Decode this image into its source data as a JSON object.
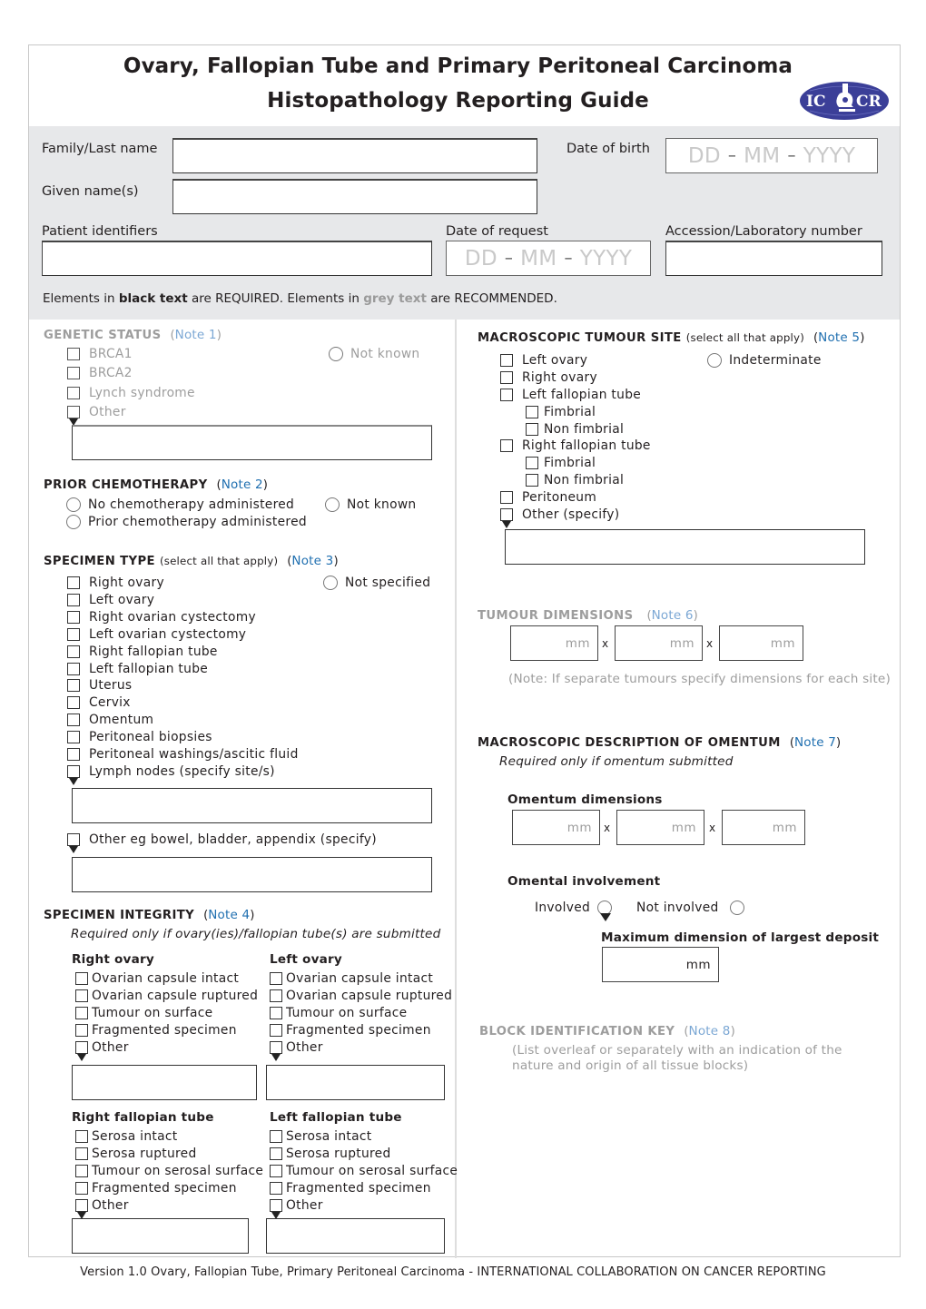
{
  "header": {
    "title_line1": "Ovary, Fallopian Tube and Primary Peritoneal Carcinoma",
    "title_line2": "Histopathology Reporting Guide",
    "logo_text_left": "IC",
    "logo_text_right": "CR",
    "logo_color": "#3b3f98"
  },
  "patient": {
    "family_name_label": "Family/Last name",
    "given_names_label": "Given name(s)",
    "dob_label": "Date of birth",
    "patient_identifiers_label": "Patient identifiers",
    "date_of_request_label": "Date of request",
    "accession_label": "Accession/Laboratory number",
    "date_placeholder": {
      "dd": "DD",
      "mm": "MM",
      "yyyy": "YYYY",
      "sep": "–"
    },
    "family_name_value": "",
    "given_names_value": "",
    "patient_identifiers_value": "",
    "accession_value": ""
  },
  "legend": {
    "prefix": "Elements in ",
    "black": "black text",
    "mid": " are REQUIRED. Elements in ",
    "grey": "grey text",
    "suffix": " are RECOMMENDED."
  },
  "genetic_status": {
    "title": "GENETIC STATUS",
    "note": "Note 1",
    "items": [
      "BRCA1",
      "BRCA2",
      "Lynch syndrome",
      "Other"
    ],
    "radio": "Not known"
  },
  "prior_chemo": {
    "title": "PRIOR CHEMOTHERAPY",
    "note": "Note 2",
    "options": [
      "No chemotherapy administered",
      "Prior chemotherapy administered",
      "Not known"
    ]
  },
  "specimen_type": {
    "title": "SPECIMEN TYPE",
    "sub": "(select all that apply)",
    "note": "Note 3",
    "items": [
      "Right ovary",
      "Left ovary",
      "Right ovarian cystectomy",
      "Left ovarian cystectomy",
      "Right fallopian tube",
      "Left fallopian tube",
      "Uterus",
      "Cervix",
      "Omentum",
      "Peritoneal biopsies",
      "Peritoneal washings/ascitic fluid",
      "Lymph nodes  (specify site/s)"
    ],
    "other_item": "Other eg bowel, bladder, appendix (specify)",
    "radio": "Not specified"
  },
  "specimen_integrity": {
    "title": "SPECIMEN INTEGRITY",
    "note": "Note 4",
    "subtitle": "Required only if ovary(ies)/fallopian tube(s) are submitted",
    "right_ovary": {
      "label": "Right ovary",
      "items": [
        "Ovarian capsule intact",
        "Ovarian capsule ruptured",
        "Tumour on surface",
        "Fragmented specimen",
        "Other"
      ]
    },
    "left_ovary": {
      "label": "Left ovary",
      "items": [
        "Ovarian capsule intact",
        "Ovarian capsule ruptured",
        "Tumour on surface",
        "Fragmented specimen",
        "Other"
      ]
    },
    "right_tube": {
      "label": "Right fallopian tube",
      "items": [
        "Serosa intact",
        "Serosa ruptured",
        "Tumour on serosal surface",
        "Fragmented specimen",
        "Other"
      ]
    },
    "left_tube": {
      "label": "Left fallopian tube",
      "items": [
        "Serosa intact",
        "Serosa ruptured",
        "Tumour on serosal surface",
        "Fragmented specimen",
        "Other"
      ]
    }
  },
  "tumour_site": {
    "title": "MACROSCOPIC TUMOUR SITE",
    "sub": "(select all that apply)",
    "note": "Note 5",
    "items": [
      "Left ovary",
      "Right ovary",
      "Left fallopian tube",
      "Fimbrial",
      "Non fimbrial",
      "Right fallopian tube",
      "Fimbrial",
      "Non fimbrial",
      "Peritoneum",
      "Other (specify)"
    ],
    "radio": "Indeterminate"
  },
  "tumour_dimensions": {
    "title": "TUMOUR DIMENSIONS",
    "note": "Note 6",
    "unit": "mm",
    "times": "x",
    "hint": "(Note: If separate tumours specify dimensions for each site)"
  },
  "omentum": {
    "title": "MACROSCOPIC DESCRIPTION OF OMENTUM",
    "note": "Note 7",
    "subtitle": "Required only if omentum submitted",
    "dimensions_label": "Omentum dimensions",
    "unit": "mm",
    "times": "x",
    "involvement_label": "Omental involvement",
    "involved": "Involved",
    "not_involved": "Not involved",
    "max_dim_label": "Maximum dimension of largest deposit"
  },
  "block_key": {
    "title": "BLOCK IDENTIFICATION KEY",
    "note": "Note 8",
    "line1": "(List overleaf or separately with an indication of the",
    "line2": "nature and origin of all tissue blocks)"
  },
  "footer": {
    "text": "Version 1.0  Ovary, Fallopian Tube, Primary Peritoneal Carcinoma - INTERNATIONAL COLLABORATION ON CANCER REPORTING"
  }
}
